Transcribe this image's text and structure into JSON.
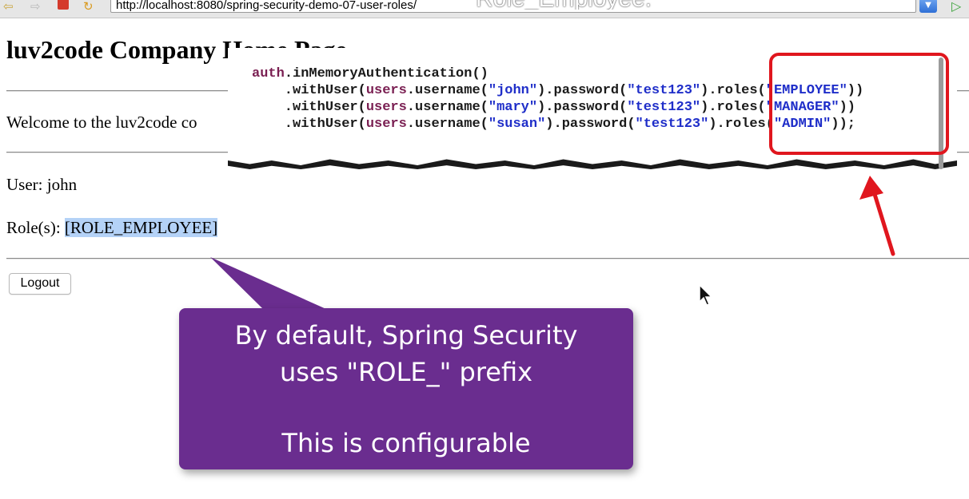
{
  "browser": {
    "url": "http://localhost:8080/spring-security-demo-07-user-roles/",
    "url_overlay_text": "Role_Employee."
  },
  "page": {
    "title": "luv2code Company Home Page",
    "welcome": "Welcome to the luv2code co",
    "user_label": "User: john",
    "roles_label": "Role(s): ",
    "roles_value": "[ROLE_EMPLOYEE]",
    "logout_label": "Logout"
  },
  "code": {
    "line1": {
      "obj": "auth",
      "rest": ".inMemoryAuthentication()"
    },
    "line2": {
      "pre": "    .withUser(",
      "users": "users",
      "mid1": ".username(",
      "name": "\"john\"",
      "mid2": ").password(",
      "pw": "\"test123\"",
      "mid3": ").roles(",
      "role": "\"EMPLOYEE\"",
      "end": "))"
    },
    "line3": {
      "pre": "    .withUser(",
      "users": "users",
      "mid1": ".username(",
      "name": "\"mary\"",
      "mid2": ").password(",
      "pw": "\"test123\"",
      "mid3": ").roles(",
      "role": "\"MANAGER\"",
      "end": "))"
    },
    "line4": {
      "pre": "    .withUser(",
      "users": "users",
      "mid1": ".username(",
      "name": "\"susan\"",
      "mid2": ").password(",
      "pw": "\"test123\"",
      "mid3": ").roles(",
      "role": "\"ADMIN\"",
      "end": "));"
    }
  },
  "callout": {
    "line1": "By default, Spring Security",
    "line2": "uses \"ROLE_\" prefix",
    "line3": "This is configurable"
  },
  "colors": {
    "callout_bg": "#6a2d8f",
    "highlight_box": "#e0161e",
    "selection": "#b4d2f7"
  },
  "icons": [
    "back-arrow-icon",
    "forward-arrow-icon",
    "stop-icon",
    "reload-icon",
    "dropdown-icon",
    "go-icon",
    "mouse-cursor-icon",
    "red-arrow-icon"
  ]
}
